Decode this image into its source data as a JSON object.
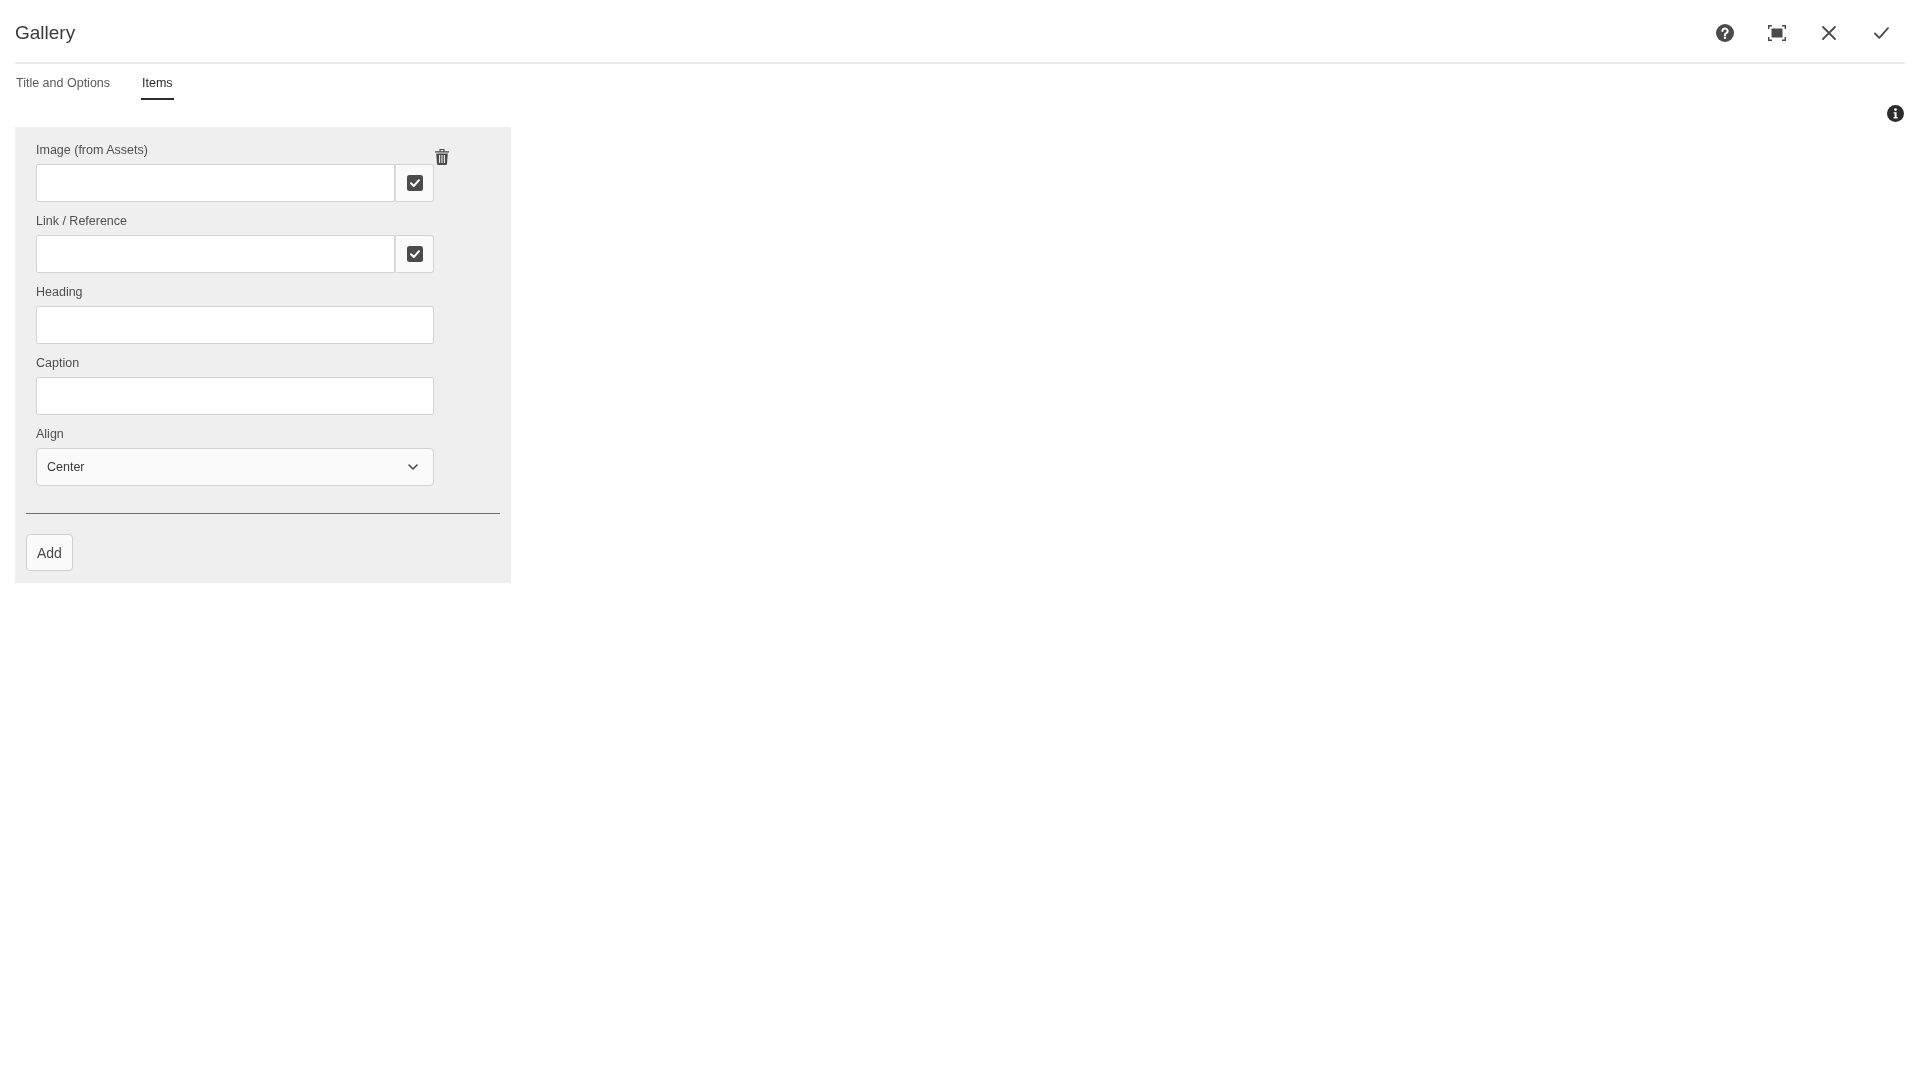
{
  "dialog": {
    "title": "Gallery"
  },
  "tabs": [
    {
      "label": "Title and Options",
      "selected": false
    },
    {
      "label": "Items",
      "selected": true
    }
  ],
  "items": [
    {
      "fields": [
        {
          "kind": "picker",
          "label": "Image (from Assets)"
        },
        {
          "kind": "picker",
          "label": "Link / Reference"
        },
        {
          "kind": "text",
          "label": "Heading"
        },
        {
          "kind": "text",
          "label": "Caption"
        },
        {
          "kind": "select",
          "label": "Align",
          "value": "Center"
        }
      ]
    }
  ],
  "add_button": "Add"
}
